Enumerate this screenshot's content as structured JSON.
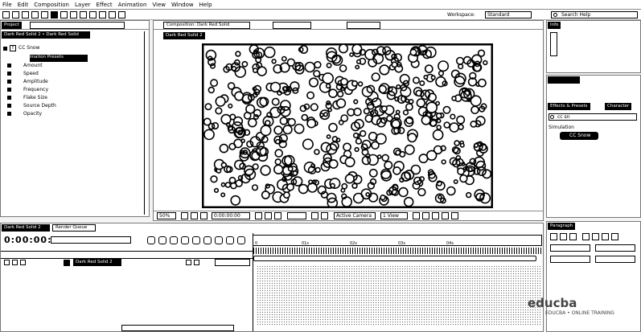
{
  "menu": [
    "File",
    "Edit",
    "Composition",
    "Layer",
    "Effect",
    "Animation",
    "View",
    "Window",
    "Help"
  ],
  "toolbar": {
    "workspace_label": "Workspace:",
    "workspace_value": "Standard",
    "search_placeholder": "Search Help"
  },
  "effect_controls": {
    "tabs": [
      "Dark Red Solid 2",
      "Dark Red Solid"
    ],
    "effect_name": "CC Snow",
    "params": [
      "Animation Presets",
      "Amount",
      "Speed",
      "Amplitude",
      "Frequency",
      "Flake Size",
      "Source Depth",
      "Opacity"
    ]
  },
  "composition": {
    "tab": "Composition: Dark Red Solid",
    "sub_tab": "Dark Red Solid 2",
    "zoom": "50%",
    "view_btns": [
      "Active Camera",
      "1 View"
    ]
  },
  "info_panel": {
    "tab": "Info"
  },
  "effects_presets": {
    "tabs": [
      "Effects & Presets",
      "Character"
    ],
    "search_value": "cc sn",
    "category": "Simulation",
    "item": "CC Snow"
  },
  "timeline": {
    "tab": "Dark Red Solid 2",
    "tab2": "Render Queue",
    "timecode": "0:00:00:00",
    "layer_name": "Dark Red Solid 2",
    "ruler_marks": [
      "01s",
      "02s",
      "03s",
      "04s"
    ]
  },
  "paragraph_panel": {
    "tab": "Paragraph"
  },
  "watermark": {
    "brand": "educba",
    "tagline": "EDUCBA • ONLINE TRAINING"
  },
  "colors": {
    "accent": "#000000",
    "surface": "#ffffff"
  }
}
